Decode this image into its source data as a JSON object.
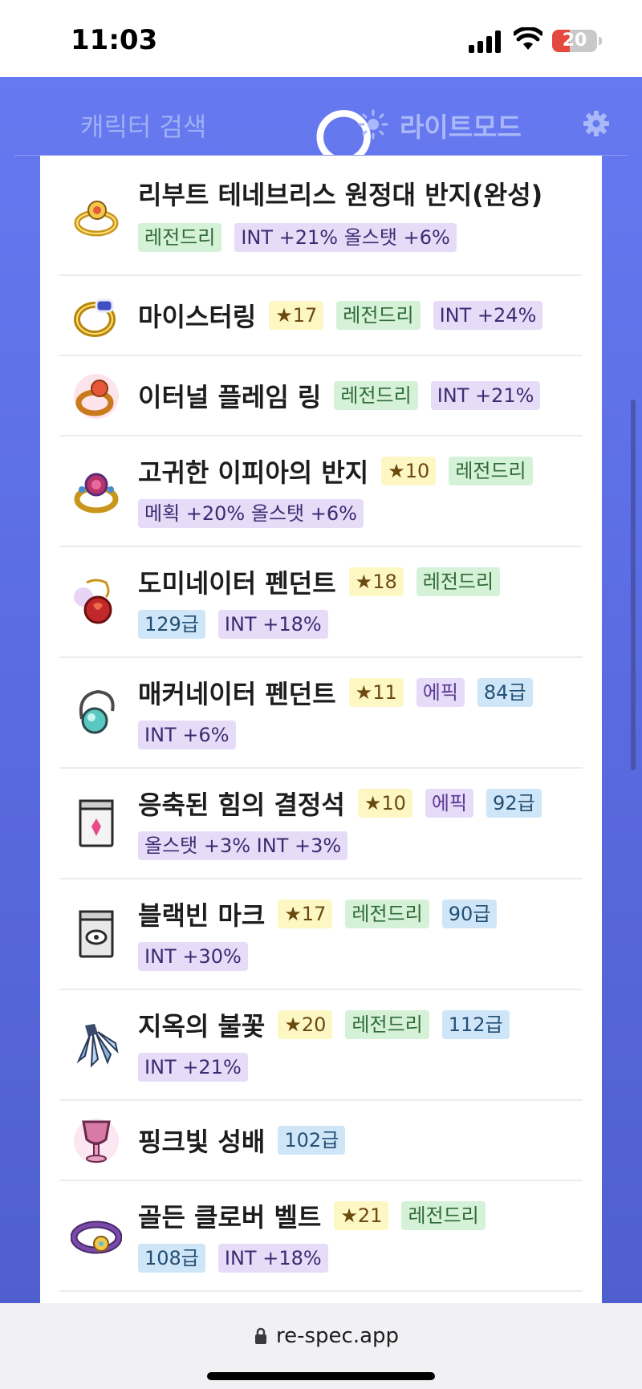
{
  "status_bar": {
    "time": "11:03",
    "battery": "20",
    "colors": {
      "battery_low": "#e5483e"
    }
  },
  "header": {
    "search_placeholder": "캐릭터 검색",
    "mode_label": "라이트모드",
    "icons": [
      "search-icon",
      "sun-icon",
      "gear-icon"
    ],
    "accent": "#6679f0"
  },
  "items": [
    {
      "name": "리부트 테네브리스 원정대 반지(완성)",
      "icon": "ring-icon",
      "tags": [
        {
          "type": "legend",
          "text": "레전드리"
        },
        {
          "type": "stat",
          "text": "INT +21% 올스탯 +6%"
        }
      ]
    },
    {
      "name": "마이스터링",
      "icon": "ring-icon",
      "tags": [
        {
          "type": "star",
          "text": "17"
        },
        {
          "type": "legend",
          "text": "레전드리"
        },
        {
          "type": "stat",
          "text": "INT +24%"
        }
      ]
    },
    {
      "name": "이터널 플레임 링",
      "icon": "ring-icon",
      "tags": [
        {
          "type": "legend",
          "text": "레전드리"
        },
        {
          "type": "stat",
          "text": "INT +21%"
        }
      ]
    },
    {
      "name": "고귀한 이피아의 반지",
      "icon": "ring-icon",
      "tags": [
        {
          "type": "star",
          "text": "10"
        },
        {
          "type": "legend",
          "text": "레전드리"
        },
        {
          "type": "stat",
          "text": "메획 +20% 올스탯 +6%"
        }
      ]
    },
    {
      "name": "도미네이터 펜던트",
      "icon": "pendant-icon",
      "tags": [
        {
          "type": "star",
          "text": "18"
        },
        {
          "type": "legend",
          "text": "레전드리"
        },
        {
          "type": "grade",
          "text": "129급"
        },
        {
          "type": "stat",
          "text": "INT +18%"
        }
      ]
    },
    {
      "name": "매커네이터 펜던트",
      "icon": "pendant-icon",
      "tags": [
        {
          "type": "star",
          "text": "11"
        },
        {
          "type": "epic",
          "text": "에픽"
        },
        {
          "type": "grade",
          "text": "84급"
        },
        {
          "type": "stat",
          "text": "INT +6%"
        }
      ]
    },
    {
      "name": "응축된 힘의 결정석",
      "icon": "pocket-icon",
      "tags": [
        {
          "type": "star",
          "text": "10"
        },
        {
          "type": "epic",
          "text": "에픽"
        },
        {
          "type": "grade",
          "text": "92급"
        },
        {
          "type": "stat",
          "text": "올스탯 +3% INT +3%"
        }
      ]
    },
    {
      "name": "블랙빈 마크",
      "icon": "badge-icon",
      "tags": [
        {
          "type": "star",
          "text": "17"
        },
        {
          "type": "legend",
          "text": "레전드리"
        },
        {
          "type": "grade",
          "text": "90급"
        },
        {
          "type": "stat",
          "text": "INT +30%"
        }
      ]
    },
    {
      "name": "지옥의 불꽃",
      "icon": "emblem-icon",
      "tags": [
        {
          "type": "star",
          "text": "20"
        },
        {
          "type": "legend",
          "text": "레전드리"
        },
        {
          "type": "grade",
          "text": "112급"
        },
        {
          "type": "stat",
          "text": "INT +21%"
        }
      ]
    },
    {
      "name": "핑크빛 성배",
      "icon": "chalice-icon",
      "tags": [
        {
          "type": "grade",
          "text": "102급"
        }
      ]
    },
    {
      "name": "골든 클로버 벨트",
      "icon": "belt-icon",
      "tags": [
        {
          "type": "star",
          "text": "21"
        },
        {
          "type": "legend",
          "text": "레전드리"
        },
        {
          "type": "grade",
          "text": "108급"
        },
        {
          "type": "stat",
          "text": "INT +18%"
        }
      ]
    }
  ],
  "url_bar": {
    "url": "re-spec.app"
  }
}
